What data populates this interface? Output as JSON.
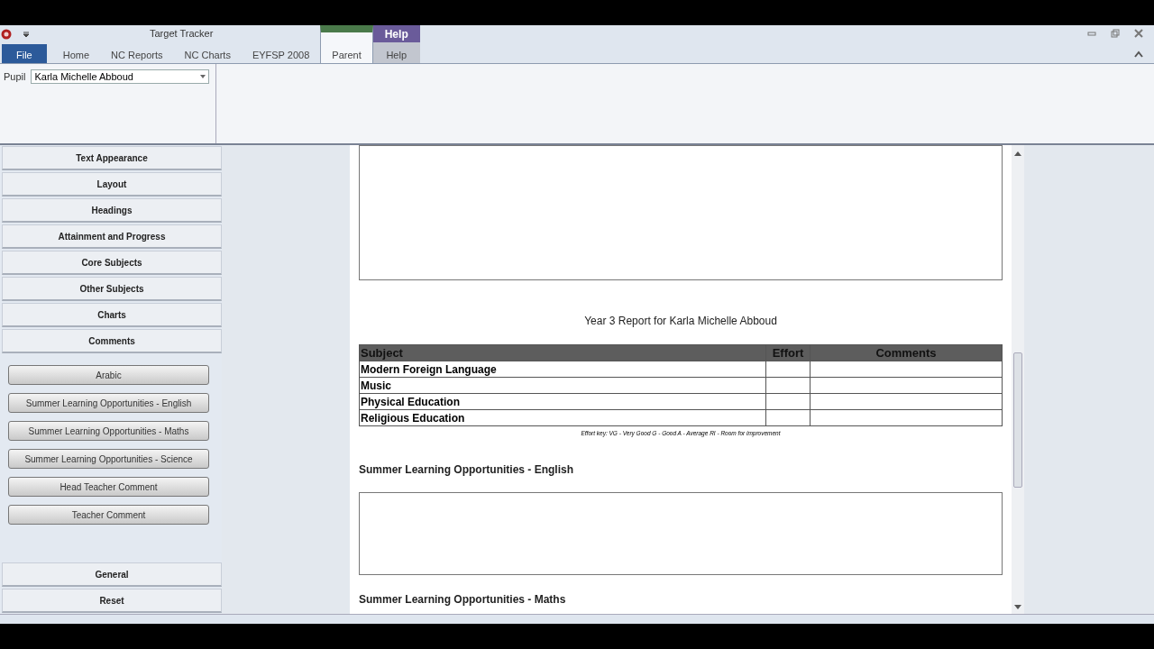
{
  "window": {
    "title": "Target Tracker"
  },
  "tabs": [
    {
      "label": "File",
      "kind": "file",
      "selected": false
    },
    {
      "label": "Home",
      "kind": "tab",
      "selected": false
    },
    {
      "label": "NC Reports",
      "kind": "tab",
      "selected": false
    },
    {
      "label": "NC Charts",
      "kind": "tab",
      "selected": false
    },
    {
      "label": "EYFSP 2008",
      "kind": "tab",
      "selected": false
    },
    {
      "label": "Parent",
      "kind": "tab",
      "selected": true
    },
    {
      "label": "Help",
      "kind": "help",
      "selected": false
    }
  ],
  "help_group": {
    "label": "Help"
  },
  "pupil": {
    "label": "Pupil",
    "value": "Karla Michelle Abboud"
  },
  "sections": [
    {
      "label": "Text Appearance"
    },
    {
      "label": "Layout"
    },
    {
      "label": "Headings"
    },
    {
      "label": "Attainment and Progress"
    },
    {
      "label": "Core Subjects"
    },
    {
      "label": "Other Subjects"
    },
    {
      "label": "Charts"
    },
    {
      "label": "Comments"
    }
  ],
  "comment_buttons": [
    "Arabic",
    "Summer Learning Opportunities - English",
    "Summer Learning Opportunities - Maths",
    "Summer Learning Opportunities - Science",
    "Head Teacher Comment",
    "Teacher Comment"
  ],
  "bottom_sections": [
    {
      "label": "General"
    },
    {
      "label": "Reset"
    }
  ],
  "report": {
    "title": "Year 3 Report for Karla Michelle Abboud",
    "columns": [
      "Subject",
      "Effort",
      "Comments"
    ],
    "rows": [
      "Modern Foreign Language",
      "Music",
      "Physical Education",
      "Religious Education"
    ],
    "key": "Effort key: VG - Very Good G - Good A - Average RI - Room for improvement",
    "headings": [
      "Summer Learning Opportunities - English",
      "Summer Learning Opportunities - Maths"
    ]
  }
}
